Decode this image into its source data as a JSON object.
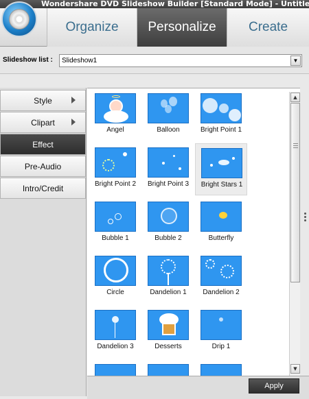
{
  "window": {
    "title": "Wondershare DVD Slideshow Builder [Standard Mode] - Untitled"
  },
  "tabs": [
    {
      "label": "Organize"
    },
    {
      "label": "Personalize"
    },
    {
      "label": "Create"
    }
  ],
  "slideshow": {
    "label": "Slideshow list :",
    "selected": "Slideshow1"
  },
  "nav": [
    {
      "label": "Style"
    },
    {
      "label": "Clipart"
    },
    {
      "label": "Effect"
    },
    {
      "label": "Pre-Audio"
    },
    {
      "label": "Intro/Credit"
    }
  ],
  "effects": [
    {
      "label": "Angel",
      "icon": "angel-thumb-icon"
    },
    {
      "label": "Balloon",
      "icon": "balloon-thumb-icon"
    },
    {
      "label": "Bright Point 1",
      "icon": "bright-point-thumb-icon"
    },
    {
      "label": "Bright Point 2",
      "icon": "bright-point-thumb-icon"
    },
    {
      "label": "Bright Point 3",
      "icon": "bright-point-thumb-icon"
    },
    {
      "label": "Bright Stars 1",
      "icon": "bright-stars-thumb-icon"
    },
    {
      "label": "Bubble 1",
      "icon": "bubble-thumb-icon"
    },
    {
      "label": "Bubble 2",
      "icon": "bubble-thumb-icon"
    },
    {
      "label": "Butterfly",
      "icon": "butterfly-thumb-icon"
    },
    {
      "label": "Circle",
      "icon": "circle-thumb-icon"
    },
    {
      "label": "Dandelion 1",
      "icon": "dandelion-thumb-icon"
    },
    {
      "label": "Dandelion 2",
      "icon": "dandelion-thumb-icon"
    },
    {
      "label": "Dandelion 3",
      "icon": "dandelion-thumb-icon"
    },
    {
      "label": "Desserts",
      "icon": "cupcake-thumb-icon"
    },
    {
      "label": "Drip 1",
      "icon": "drip-thumb-icon"
    }
  ],
  "footer": {
    "apply_label": "Apply"
  },
  "colors": {
    "thumb_blue": "#2f96f0",
    "active_tab": "#4a4a4a",
    "tab_text": "#3b6e8e"
  }
}
